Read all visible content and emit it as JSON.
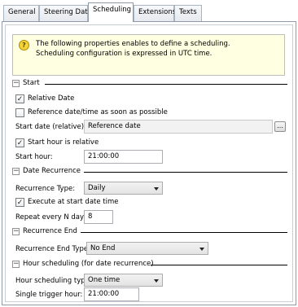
{
  "tabs": [
    {
      "label": "General"
    },
    {
      "label": "Steering Date"
    },
    {
      "label": "Scheduling"
    },
    {
      "label": "Extensions"
    },
    {
      "label": "Texts"
    }
  ],
  "active_tab": "Scheduling",
  "info": {
    "line1": "The following properties enables to define a scheduling.",
    "line2": "Scheduling configuration is expressed in UTC time."
  },
  "start": {
    "title": "Start",
    "relative_date": {
      "label": "Relative Date",
      "checked": true
    },
    "reference_asap": {
      "label": "Reference date/time as soon as possible",
      "checked": false
    },
    "start_date_label": "Start date (relative):",
    "start_date_value": "Reference date",
    "browse_label": "...",
    "start_hour_relative": {
      "label": "Start hour is relative",
      "checked": true
    },
    "start_hour_label": "Start hour:",
    "start_hour_value": "21:00:00"
  },
  "date_recurrence": {
    "title": "Date Recurrence",
    "type_label": "Recurrence Type:",
    "type_value": "Daily",
    "execute_at_start": {
      "label": "Execute at start date  time",
      "checked": true
    },
    "repeat_label": "Repeat every N days:",
    "repeat_value": "8"
  },
  "recurrence_end": {
    "title": "Recurrence End",
    "type_label": "Recurrence End Type:",
    "type_value": "No End"
  },
  "hour_scheduling": {
    "title": "Hour scheduling (for date recurrence)",
    "type_label": "Hour scheduling type:",
    "type_value": "One time",
    "trigger_label": "Single trigger hour:",
    "trigger_value": "21:00:00"
  },
  "icons": {
    "info": "lightbulb-icon",
    "collapse": "minus-box-icon",
    "checkbox": "check-icon",
    "dropdown": "chevron-down-icon"
  },
  "colors": {
    "info_background": "#ffffe1",
    "icon_yellow": "#f4d43a",
    "readonly_field": "#f2f2f2"
  }
}
